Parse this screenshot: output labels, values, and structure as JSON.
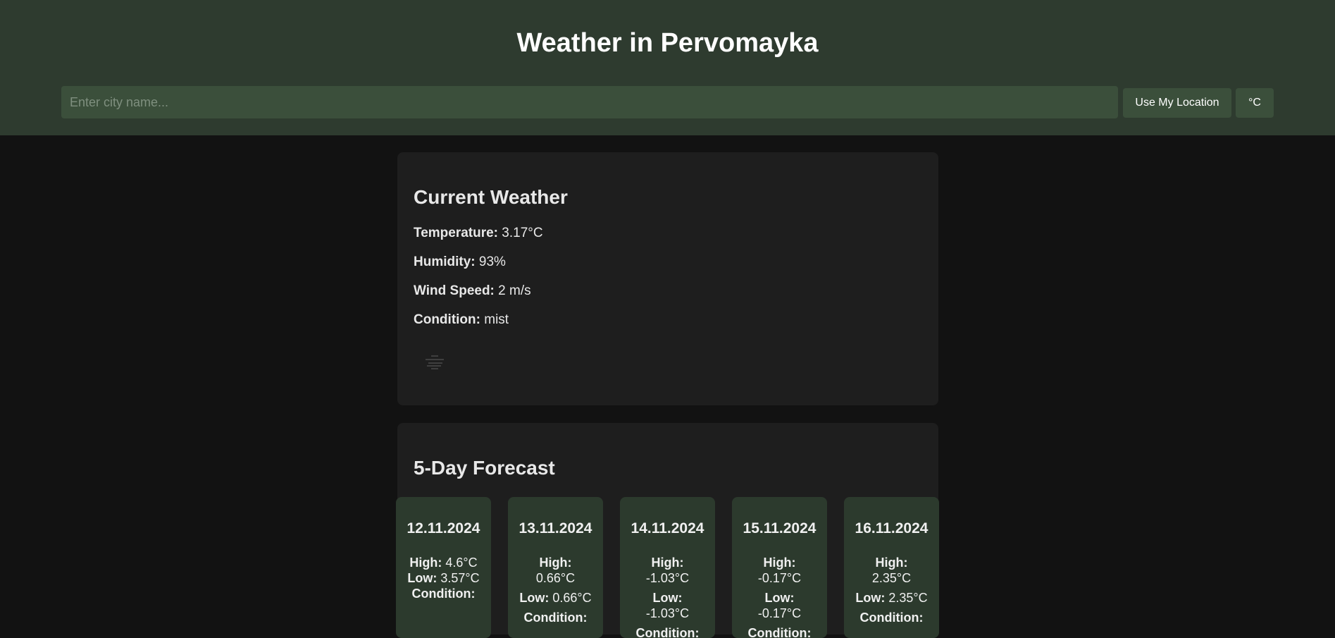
{
  "header": {
    "title": "Weather in Pervomayka",
    "search_placeholder": "Enter city name...",
    "location_button": "Use My Location",
    "unit_button": "°C"
  },
  "current": {
    "title": "Current Weather",
    "temperature_label": "Temperature:",
    "temperature_value": "3.17°C",
    "humidity_label": "Humidity:",
    "humidity_value": "93%",
    "wind_label": "Wind Speed:",
    "wind_value": "2 m/s",
    "condition_label": "Condition:",
    "condition_value": "mist",
    "icon": "mist-icon"
  },
  "forecast": {
    "title": "5-Day Forecast",
    "high_label": "High:",
    "low_label": "Low:",
    "condition_label": "Condition:",
    "days": [
      {
        "date": "12.11.2024",
        "high": "4.6°C",
        "low": "3.57°C"
      },
      {
        "date": "13.11.2024",
        "high": "0.66°C",
        "low": "0.66°C"
      },
      {
        "date": "14.11.2024",
        "high": "-1.03°C",
        "low": "-1.03°C"
      },
      {
        "date": "15.11.2024",
        "high": "-0.17°C",
        "low": "-0.17°C"
      },
      {
        "date": "16.11.2024",
        "high": "2.35°C",
        "low": "2.35°C"
      }
    ]
  }
}
